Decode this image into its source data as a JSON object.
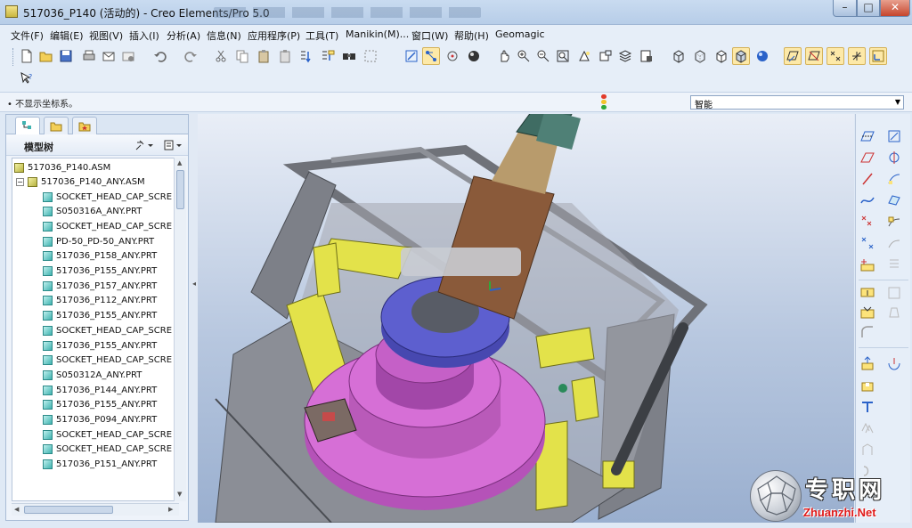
{
  "window": {
    "title": "517036_P140 (活动的) - Creo Elements/Pro 5.0"
  },
  "menubar": {
    "items": [
      "文件(F)",
      "编辑(E)",
      "视图(V)",
      "插入(I)",
      "分析(A)",
      "信息(N)",
      "应用程序(P)",
      "工具(T)",
      "Manikin(M)...",
      "窗口(W)",
      "帮助(H)",
      "Geomagic"
    ]
  },
  "message": {
    "text": "• 不显示坐标系。"
  },
  "smart_filter": {
    "value": "智能"
  },
  "model_tree": {
    "title": "模型树",
    "root": "517036_P140.ASM",
    "subassembly": "517036_P140_ANY.ASM",
    "items": [
      "SOCKET_HEAD_CAP_SCRE",
      "S050316A_ANY.PRT",
      "SOCKET_HEAD_CAP_SCRE",
      "PD-50_PD-50_ANY.PRT",
      "517036_P158_ANY.PRT",
      "517036_P155_ANY.PRT",
      "517036_P157_ANY.PRT",
      "517036_P112_ANY.PRT",
      "517036_P155_ANY.PRT",
      "SOCKET_HEAD_CAP_SCRE",
      "517036_P155_ANY.PRT",
      "SOCKET_HEAD_CAP_SCRE",
      "S050312A_ANY.PRT",
      "517036_P144_ANY.PRT",
      "517036_P155_ANY.PRT",
      "517036_P094_ANY.PRT",
      "SOCKET_HEAD_CAP_SCRE",
      "SOCKET_HEAD_CAP_SCRE",
      "517036_P151_ANY.PRT"
    ]
  },
  "watermark": {
    "chinese": "专职网",
    "domain": "Zhuanzhi.Net"
  },
  "colors": {
    "accent": "#fde9a8",
    "part_icon": "#3fb3b0",
    "asm_icon": "#b6b240",
    "frame_gray": "#7d8088",
    "plate_yellow": "#e3e24a",
    "flange_blue": "#5d5fcf",
    "base_pink": "#d66fd6",
    "shaft_brown": "#8a5a3a",
    "spline_teal": "#3f6c63",
    "watermark_red": "#e01818"
  },
  "toolbar_icons": [
    "new-icon",
    "open-icon",
    "save-icon",
    "print-icon",
    "email-icon",
    "email-link-icon",
    "undo-icon",
    "redo-icon",
    "cut-icon",
    "copy-icon",
    "paste-icon",
    "paste-special-icon",
    "regenerate-icon",
    "regenerate-manager-icon",
    "find-icon",
    "select-box-icon",
    "repaint-icon",
    "spin-center-icon",
    "orient-mode-icon",
    "appearance-icon",
    "pan-icon",
    "zoom-in-icon",
    "zoom-out-icon",
    "refit-icon",
    "reorient-icon",
    "saved-views-icon",
    "layers-icon",
    "view-manager-icon",
    "wireframe-icon",
    "hidden-line-icon",
    "no-hidden-icon",
    "shading-icon",
    "enhanced-realism-icon",
    "datum-planes-icon",
    "datum-axes-icon",
    "datum-points-icon",
    "csys-icon",
    "whats-this-icon"
  ]
}
